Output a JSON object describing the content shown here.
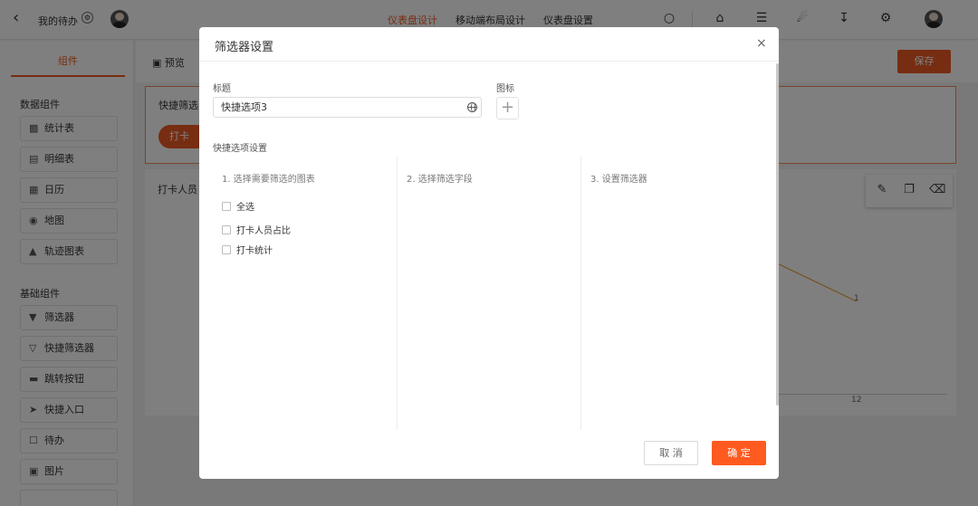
{
  "topbar": {
    "back_icon": "chevron-left-icon",
    "title": "我的待办",
    "title_icon": "settings-circle-icon",
    "tabs": [
      {
        "label": "仪表盘设计",
        "active": true
      },
      {
        "label": "移动端布局设计",
        "active": false
      },
      {
        "label": "仪表盘设置",
        "active": false
      }
    ],
    "icons": [
      "search-icon",
      "home-icon",
      "shirt-icon",
      "megaphone-icon",
      "download-icon",
      "settings-icon"
    ],
    "accent_color": "#ee5a24"
  },
  "left_panel": {
    "tab_label": "组件",
    "groups": [
      {
        "label": "数据组件",
        "items": [
          {
            "label": "统计表",
            "icon": "bar-chart-icon"
          },
          {
            "label": "明细表",
            "icon": "table-icon"
          },
          {
            "label": "日历",
            "icon": "calendar-icon"
          },
          {
            "label": "地图",
            "icon": "map-pin-icon"
          },
          {
            "label": "轨迹图表",
            "icon": "route-icon"
          }
        ]
      },
      {
        "label": "基础组件",
        "items": [
          {
            "label": "筛选器",
            "icon": "filter-icon"
          },
          {
            "label": "快捷筛选器",
            "icon": "quick-filter-icon"
          },
          {
            "label": "跳转按钮",
            "icon": "link-button-icon"
          },
          {
            "label": "快捷入口",
            "icon": "send-icon"
          },
          {
            "label": "待办",
            "icon": "todo-icon"
          },
          {
            "label": "图片",
            "icon": "image-icon"
          }
        ]
      }
    ]
  },
  "canvas": {
    "preview_label": "预览",
    "save_label": "保存",
    "card1_label": "快捷筛选",
    "card1_pill": "打卡",
    "card2_label": "打卡人员",
    "chart_point_label": "1",
    "chart_tick": "12",
    "tool_icons": [
      "edit-icon",
      "copy-icon",
      "delete-icon"
    ]
  },
  "dialog": {
    "title": "筛选器设置",
    "close_icon": "close-icon",
    "title_field_label": "标题",
    "title_value": "快捷选项3",
    "title_field_icon": "globe-icon",
    "icon_field_label": "图标",
    "icon_add": "+",
    "section_label": "快捷选项设置",
    "columns": [
      {
        "title": "1. 选择需要筛选的图表"
      },
      {
        "title": "2. 选择筛选字段"
      },
      {
        "title": "3. 设置筛选器"
      }
    ],
    "select_all_label": "全选",
    "charts": [
      {
        "label": "打卡人员占比",
        "checked": false
      },
      {
        "label": "打卡统计",
        "checked": false
      }
    ],
    "cancel_label": "取 消",
    "ok_label": "确 定",
    "ok_color": "#ff5a1f"
  }
}
